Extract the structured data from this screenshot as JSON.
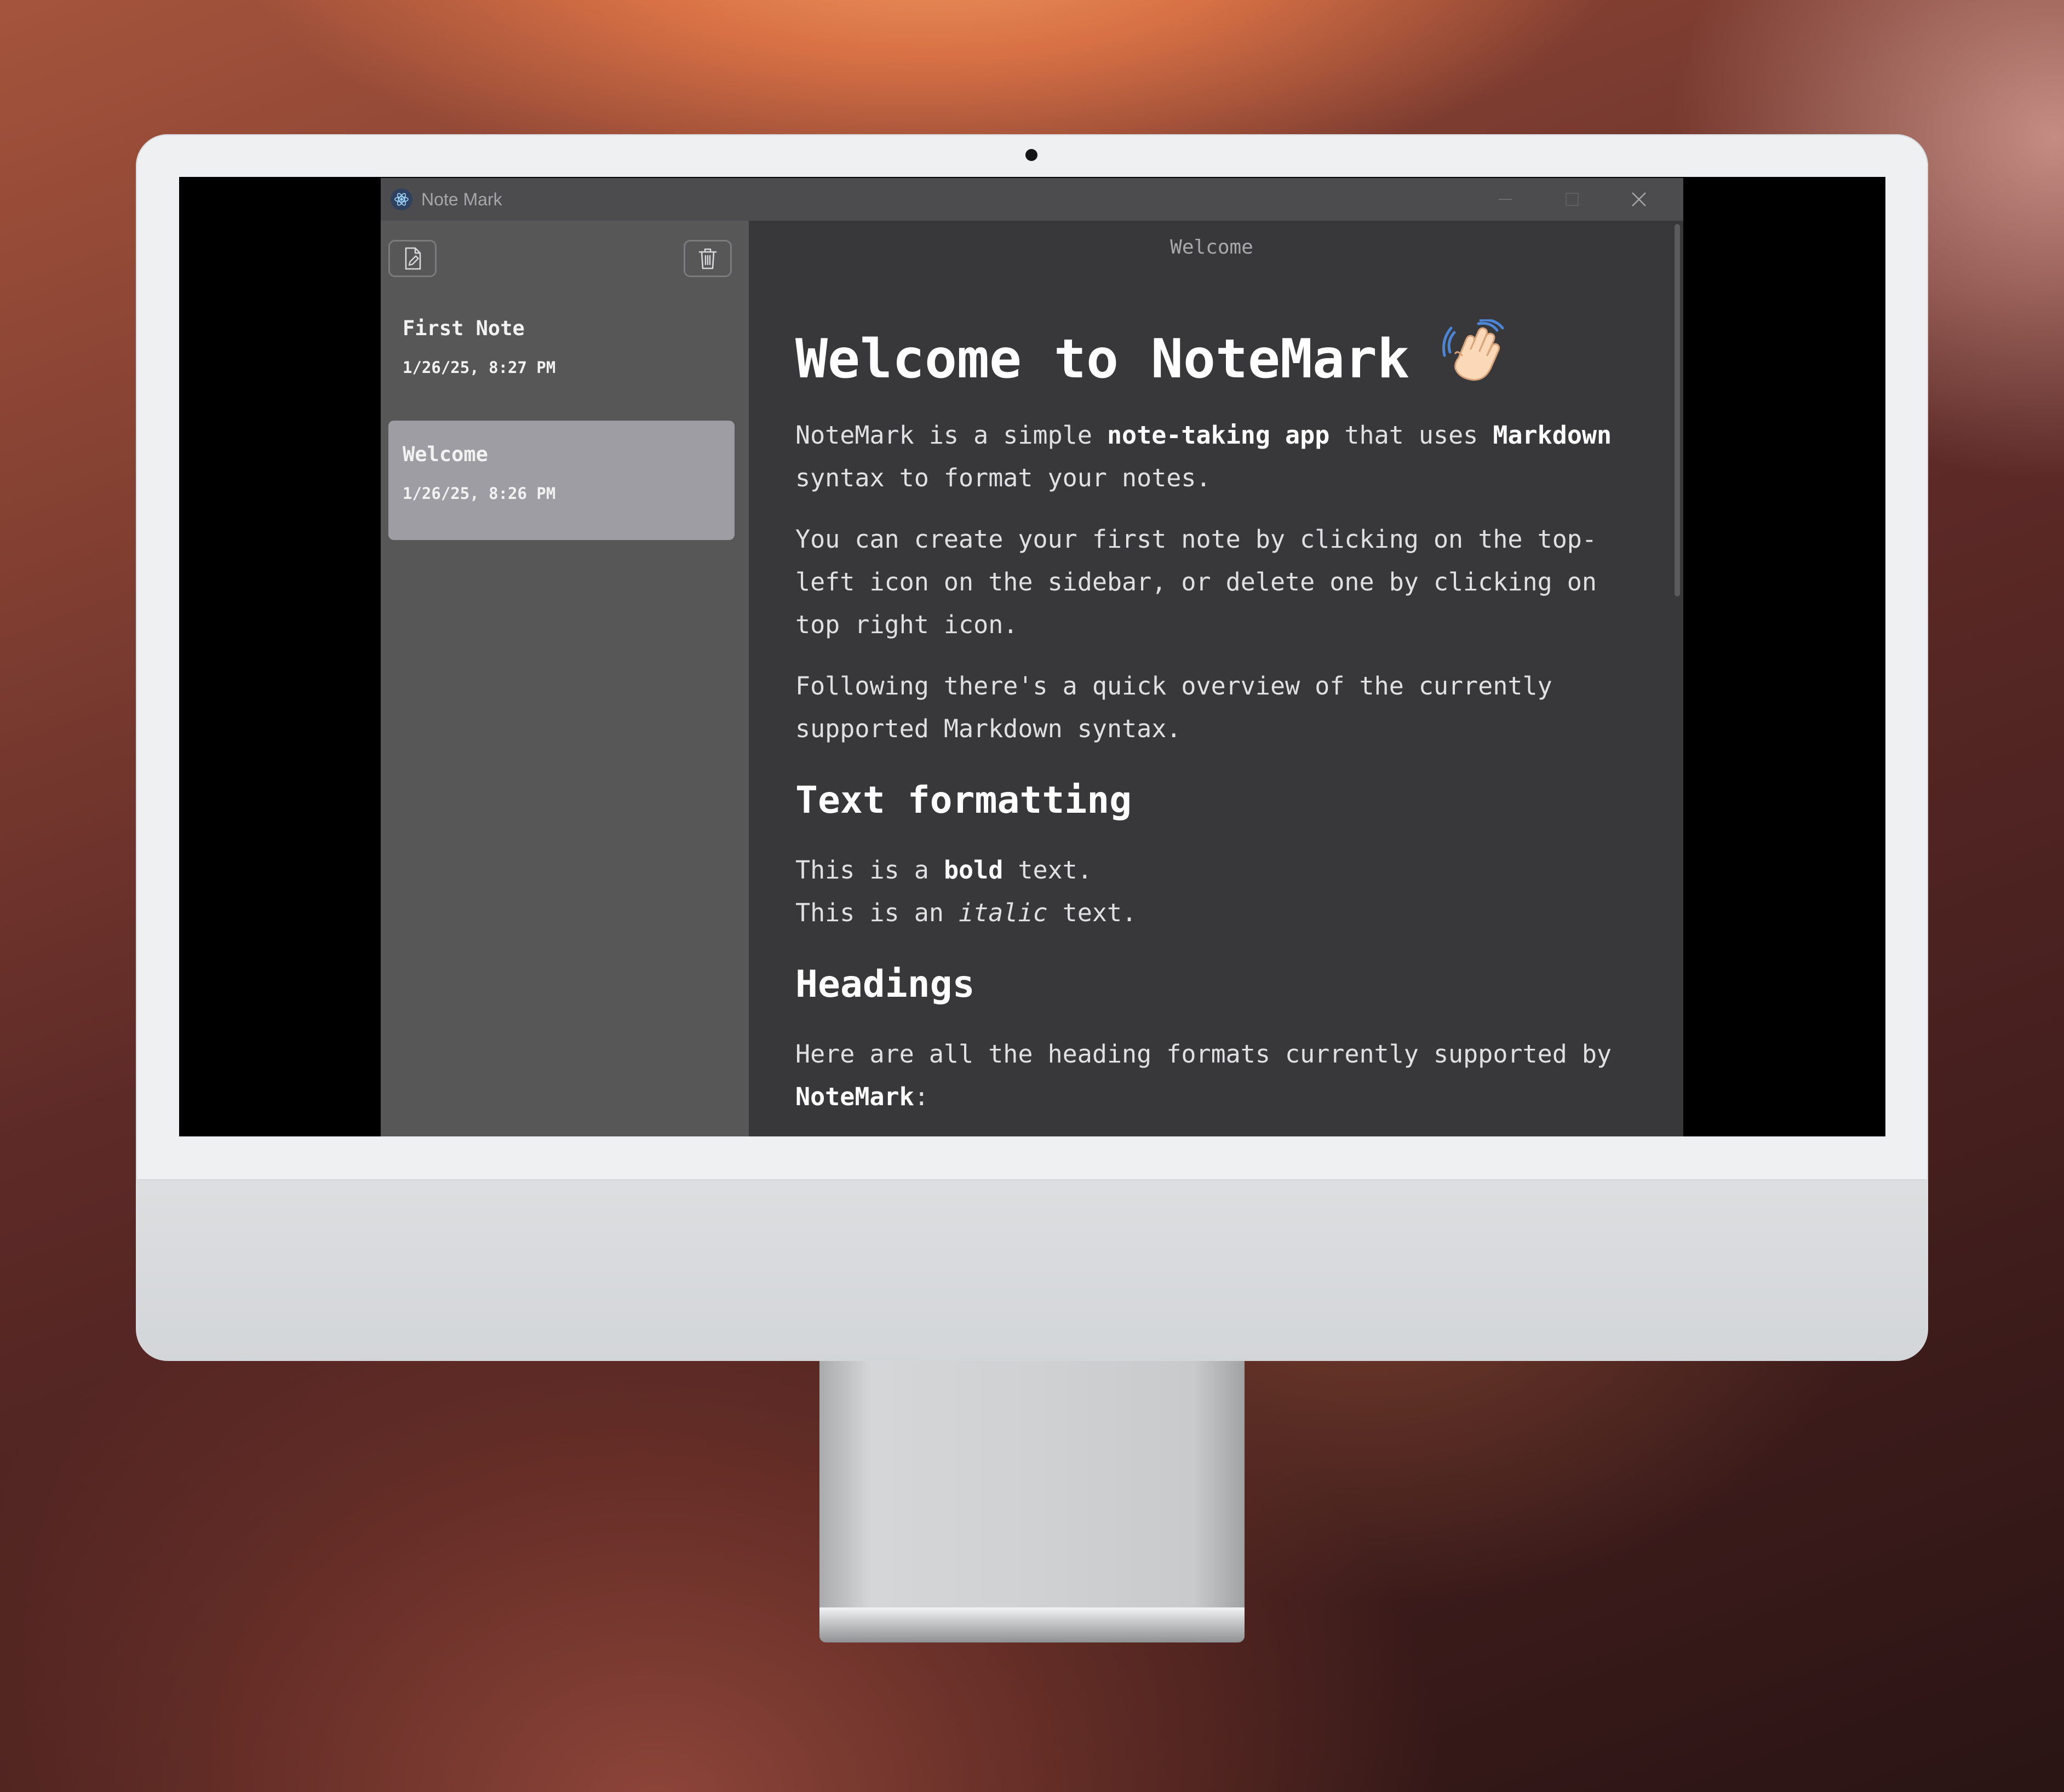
{
  "window": {
    "title": "Note Mark"
  },
  "sidebar": {
    "notes": [
      {
        "title": "First Note",
        "date": "1/26/25, 8:27 PM",
        "selected": false
      },
      {
        "title": "Welcome",
        "date": "1/26/25, 8:26 PM",
        "selected": true
      }
    ]
  },
  "editor": {
    "title": "Welcome",
    "heading": "Welcome to NoteMark",
    "p1": {
      "a": "NoteMark is a simple ",
      "b": "note-taking app",
      "c": " that uses ",
      "d": "Markdown",
      "line2": "syntax to format your notes."
    },
    "p2": {
      "l1": "You can create your first note by clicking on the top-",
      "l2": "left icon on the sidebar, or delete one by clicking on",
      "l3": "top right icon."
    },
    "p3": {
      "l1": "Following there's a quick overview of the currently",
      "l2": "supported Markdown syntax."
    },
    "h_text_formatting": "Text formatting",
    "bold_line": {
      "a": "This is a ",
      "b": "bold",
      "c": " text."
    },
    "italic_line": {
      "a": "This is an ",
      "b": "italic",
      "c": " text."
    },
    "h_headings": "Headings",
    "p4": {
      "l1": "Here are all the heading formats currently supported by",
      "b": "NoteMark",
      "c": ":"
    }
  },
  "icons": {
    "app": "electron-icon",
    "new_note": "new-note-icon",
    "delete": "trash-icon",
    "wave": "waving-hand-icon"
  },
  "colors": {
    "sidebar": "#575758",
    "selected_note": "#9d9da3",
    "editor": "#38383b",
    "titlebar": "#4c4c4e"
  }
}
